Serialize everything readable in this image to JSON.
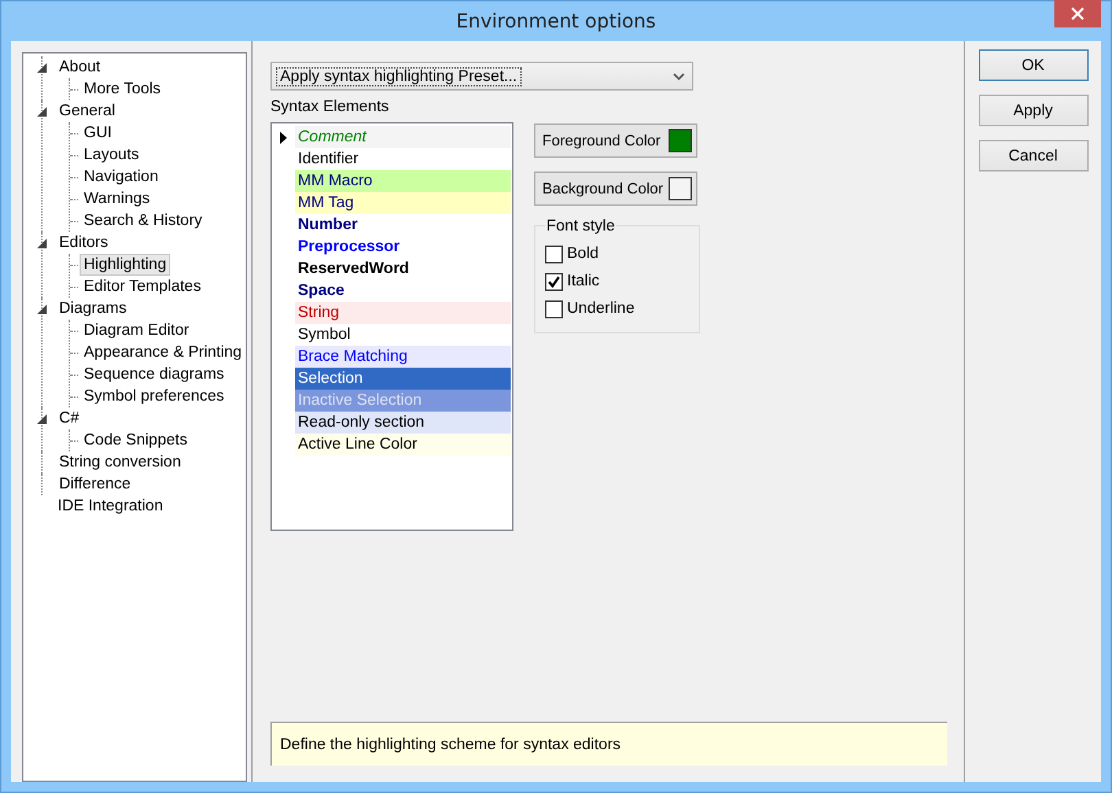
{
  "window": {
    "title": "Environment options"
  },
  "tree": [
    {
      "label": "About",
      "expanded": true,
      "selected": false,
      "children": [
        {
          "label": "More Tools",
          "selected": false
        }
      ]
    },
    {
      "label": "General",
      "expanded": true,
      "selected": false,
      "children": [
        {
          "label": "GUI",
          "selected": false
        },
        {
          "label": "Layouts",
          "selected": false
        },
        {
          "label": "Navigation",
          "selected": false
        },
        {
          "label": "Warnings",
          "selected": false
        },
        {
          "label": "Search & History",
          "selected": false
        }
      ]
    },
    {
      "label": "Editors",
      "expanded": true,
      "selected": false,
      "children": [
        {
          "label": "Highlighting",
          "selected": true
        },
        {
          "label": "Editor Templates",
          "selected": false
        }
      ]
    },
    {
      "label": "Diagrams",
      "expanded": true,
      "selected": false,
      "children": [
        {
          "label": "Diagram Editor",
          "selected": false
        },
        {
          "label": "Appearance & Printing",
          "selected": false
        },
        {
          "label": "Sequence diagrams",
          "selected": false
        },
        {
          "label": "Symbol preferences",
          "selected": false
        }
      ]
    },
    {
      "label": "C#",
      "expanded": true,
      "selected": false,
      "children": [
        {
          "label": "Code Snippets",
          "selected": false
        }
      ]
    },
    {
      "label": "String conversion",
      "selected": false
    },
    {
      "label": "Difference",
      "selected": false
    },
    {
      "label": "IDE Integration",
      "selected": false
    }
  ],
  "preset_dropdown": {
    "value": "Apply syntax highlighting Preset..."
  },
  "syntax_elements": {
    "label": "Syntax Elements",
    "items": [
      {
        "name": "Comment",
        "selected": true,
        "kind": "comment"
      },
      {
        "name": "Identifier",
        "selected": false,
        "kind": "identifier"
      },
      {
        "name": "MM Macro",
        "selected": false,
        "kind": "macro"
      },
      {
        "name": "MM Tag",
        "selected": false,
        "kind": "tag"
      },
      {
        "name": "Number",
        "selected": false,
        "kind": "number"
      },
      {
        "name": "Preprocessor",
        "selected": false,
        "kind": "preprocessor"
      },
      {
        "name": "ReservedWord",
        "selected": false,
        "kind": "reserved"
      },
      {
        "name": "Space",
        "selected": false,
        "kind": "space"
      },
      {
        "name": "String",
        "selected": false,
        "kind": "string"
      },
      {
        "name": "Symbol",
        "selected": false,
        "kind": "symbol"
      },
      {
        "name": "Brace Matching",
        "selected": false,
        "kind": "brace"
      },
      {
        "name": "Selection",
        "selected": false,
        "kind": "selection"
      },
      {
        "name": "Inactive Selection",
        "selected": false,
        "kind": "inactive"
      },
      {
        "name": "Read-only section",
        "selected": false,
        "kind": "readonly"
      },
      {
        "name": "Active Line Color",
        "selected": false,
        "kind": "activeline"
      }
    ]
  },
  "color_buttons": [
    {
      "label": "Foreground Color",
      "color": "#008000"
    },
    {
      "label": "Background Color",
      "color": "#f4f4f4"
    }
  ],
  "font_style": {
    "title": "Font style",
    "options": [
      {
        "label": "Bold",
        "checked": false
      },
      {
        "label": "Italic",
        "checked": true
      },
      {
        "label": "Underline",
        "checked": false
      }
    ]
  },
  "description": "Define the highlighting scheme for syntax editors",
  "buttons": [
    {
      "label": "OK",
      "default": true
    },
    {
      "label": "Apply",
      "default": false
    },
    {
      "label": "Cancel",
      "default": false
    }
  ]
}
